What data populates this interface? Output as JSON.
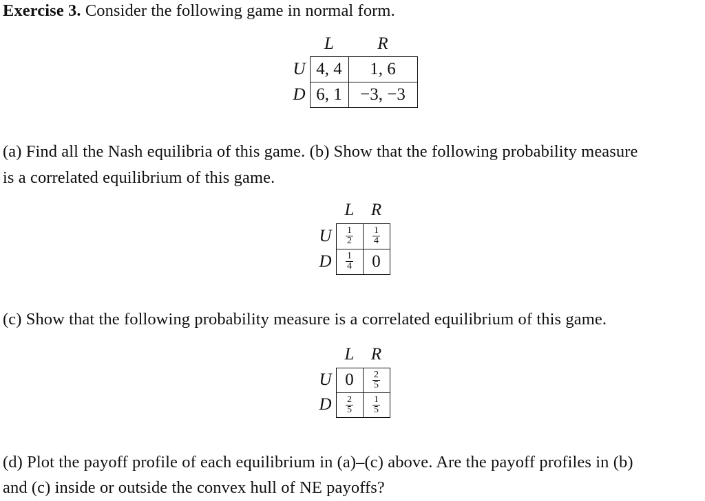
{
  "intro": {
    "label": "Exercise 3.",
    "text": "Consider the following game in normal form."
  },
  "game": {
    "col_labels": [
      "L",
      "R"
    ],
    "row_labels": [
      "U",
      "D"
    ],
    "payoffs": [
      [
        "4, 4",
        "1, 6"
      ],
      [
        "6, 1",
        "−3, −3"
      ]
    ]
  },
  "part_ab": {
    "line1": "(a) Find all the Nash equilibria of this game. (b) Show that the following probability measure",
    "line2": "is a correlated equilibrium of this game."
  },
  "measure_b": {
    "col_labels": [
      "L",
      "R"
    ],
    "row_labels": [
      "U",
      "D"
    ],
    "cells": [
      [
        {
          "num": "1",
          "den": "2"
        },
        {
          "num": "1",
          "den": "4"
        }
      ],
      [
        {
          "num": "1",
          "den": "4"
        },
        {
          "value": "0"
        }
      ]
    ]
  },
  "part_c": {
    "line1": "(c) Show that the following probability measure is a correlated equilibrium of this game."
  },
  "measure_c": {
    "col_labels": [
      "L",
      "R"
    ],
    "row_labels": [
      "U",
      "D"
    ],
    "cells": [
      [
        {
          "value": "0"
        },
        {
          "num": "2",
          "den": "5"
        }
      ],
      [
        {
          "num": "2",
          "den": "5"
        },
        {
          "num": "1",
          "den": "5"
        }
      ]
    ]
  },
  "part_d": {
    "line1": "(d) Plot the payoff profile of each equilibrium in (a)–(c) above. Are the payoff profiles in (b)",
    "line2": "and (c) inside or outside the convex hull of NE payoffs?"
  }
}
